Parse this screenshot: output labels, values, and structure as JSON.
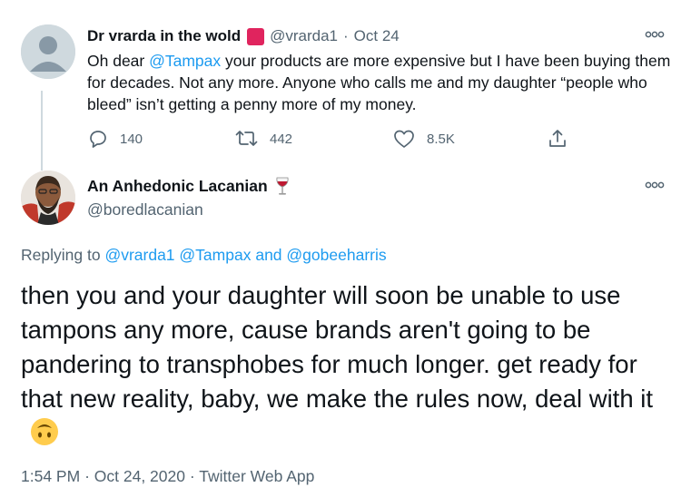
{
  "parent_tweet": {
    "display_name": "Dr vrarda in the wold",
    "handle": "@vrarda1",
    "separator": "·",
    "date": "Oct 24",
    "text_part1": "Oh dear ",
    "mention": "@Tampax",
    "text_part2": " your products are more expensive but I have been buying them for decades. Not any more. Anyone who calls me and my daughter “people who bleed” isn’t getting a penny more of my money.",
    "counts": {
      "replies": "140",
      "retweets": "442",
      "likes": "8.5K"
    }
  },
  "reply_tweet": {
    "display_name": "An Anhedonic Lacanian",
    "handle": "@boredlacanian",
    "replying_prefix": "Replying to",
    "replying_mentions": [
      "@vrarda1",
      "@Tampax",
      "@gobeeharris"
    ],
    "replying_and": "and",
    "text": "then you and your daughter will soon be unable to use tampons any more, cause brands aren't going to be pandering to transphobes for much longer. get ready for that new reality, baby, we make the rules now, deal with it",
    "time": "1:54 PM",
    "date": "Oct 24, 2020",
    "source": "Twitter Web App",
    "separator": "·"
  },
  "icons": {
    "more": "more-horizontal-icon",
    "reply": "reply-icon",
    "retweet": "retweet-icon",
    "like": "heart-icon",
    "share": "share-icon",
    "wine": "wine-glass-emoji",
    "upside_down": "upside-down-face-emoji"
  },
  "colors": {
    "link": "#1d9bf0",
    "muted": "#536471",
    "text": "#0f1419",
    "red_square": "#e0245e",
    "thread_line": "#cfd9de"
  }
}
